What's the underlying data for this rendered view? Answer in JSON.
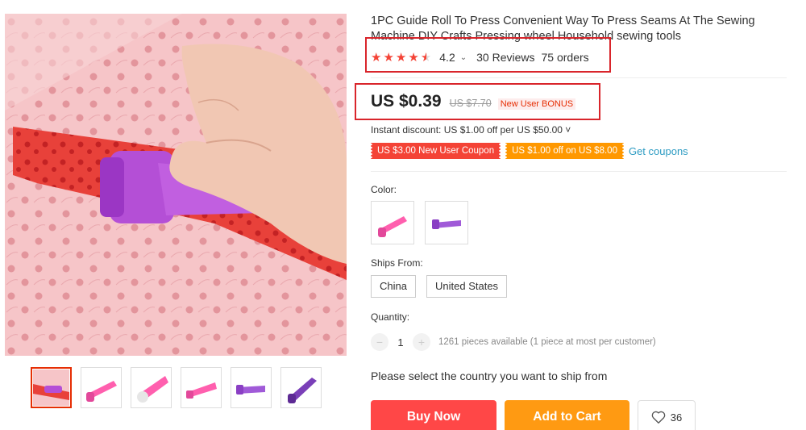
{
  "product": {
    "title": "1PC Guide Roll To Press Convenient Way To Press Seams At The Sewing Machine DIY Crafts Pressing wheel Household sewing tools",
    "rating_value": "4.2",
    "reviews": "30 Reviews",
    "orders": "75 orders",
    "stars": 4.5
  },
  "price": {
    "current": "US $0.39",
    "original": "US $7.70",
    "bonus_badge": "New User BONUS"
  },
  "discount": {
    "instant_text": "Instant discount: US $1.00 off per US $50.00 ˅",
    "coupons": [
      "US $3.00 New User Coupon",
      "US $1.00 off on US $8.00"
    ],
    "get_coupons": "Get coupons"
  },
  "color": {
    "label": "Color:",
    "options": [
      "pink-roller",
      "purple-roller"
    ]
  },
  "ships_from": {
    "label": "Ships From:",
    "options": [
      "China",
      "United States"
    ]
  },
  "quantity": {
    "label": "Quantity:",
    "value": "1",
    "minus": "−",
    "plus": "+",
    "available": "1261 pieces available (1 piece at most per customer)"
  },
  "shipping_message": "Please select the country you want to ship from",
  "actions": {
    "buy_now": "Buy Now",
    "add_to_cart": "Add to Cart",
    "wishlist_count": "36"
  },
  "colors": {
    "accent_red": "#ff4747",
    "accent_orange": "#ff9a12",
    "highlight_box": "#d9252b",
    "star": "#f44336",
    "link": "#2e9cc3"
  }
}
